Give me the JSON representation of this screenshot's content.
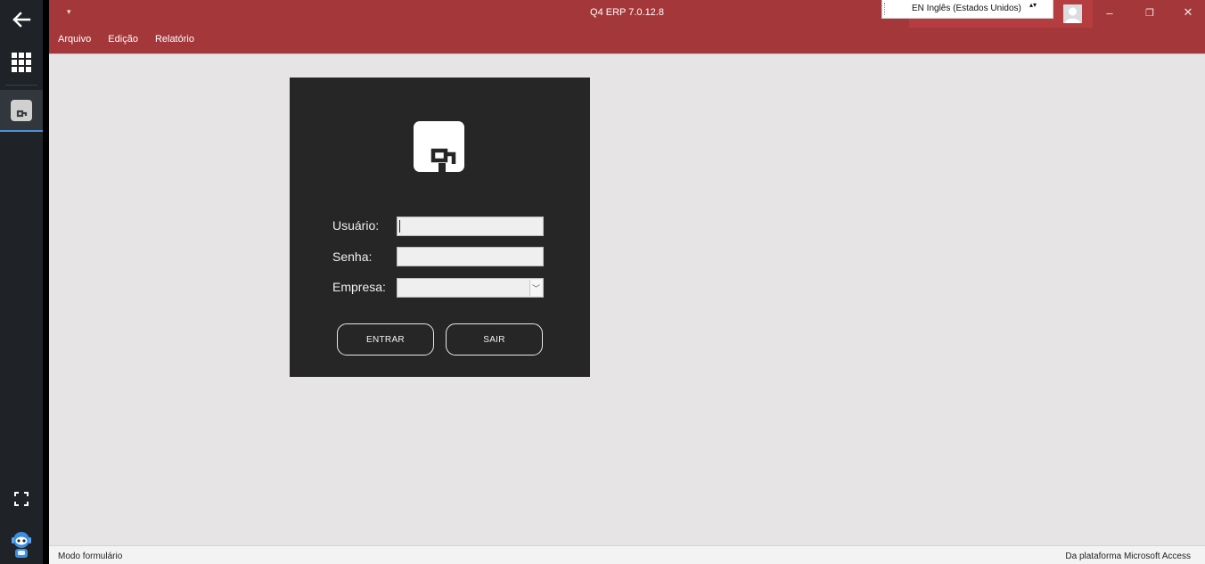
{
  "window": {
    "title": "Q4 ERP 7.0.12.8",
    "quick_access": "▾",
    "menu": [
      "Arquivo",
      "Edição",
      "Relatório"
    ],
    "controls": {
      "minimize": "–",
      "restore": "❐",
      "close": "✕"
    }
  },
  "language_bar": {
    "text": "EN Inglês (Estados Unidos)",
    "spin": "▴▾"
  },
  "login": {
    "usuario_label": "Usuário:",
    "senha_label": "Senha:",
    "empresa_label": "Empresa:",
    "usuario_value": "",
    "senha_value": "",
    "empresa_value": "",
    "enter_button": "ENTRAR",
    "exit_button": "SAIR"
  },
  "statusbar": {
    "left": "Modo formulário",
    "right": "Da plataforma Microsoft Access"
  },
  "colors": {
    "titlebar": "#a4373a",
    "panel": "#262626",
    "sidebar": "#1f2227",
    "accent": "#4a90d9"
  },
  "icons": [
    "back-arrow-icon",
    "apps-grid-icon",
    "q4-app-icon",
    "fullscreen-icon",
    "assistant-robot-icon",
    "q4-logo"
  ]
}
